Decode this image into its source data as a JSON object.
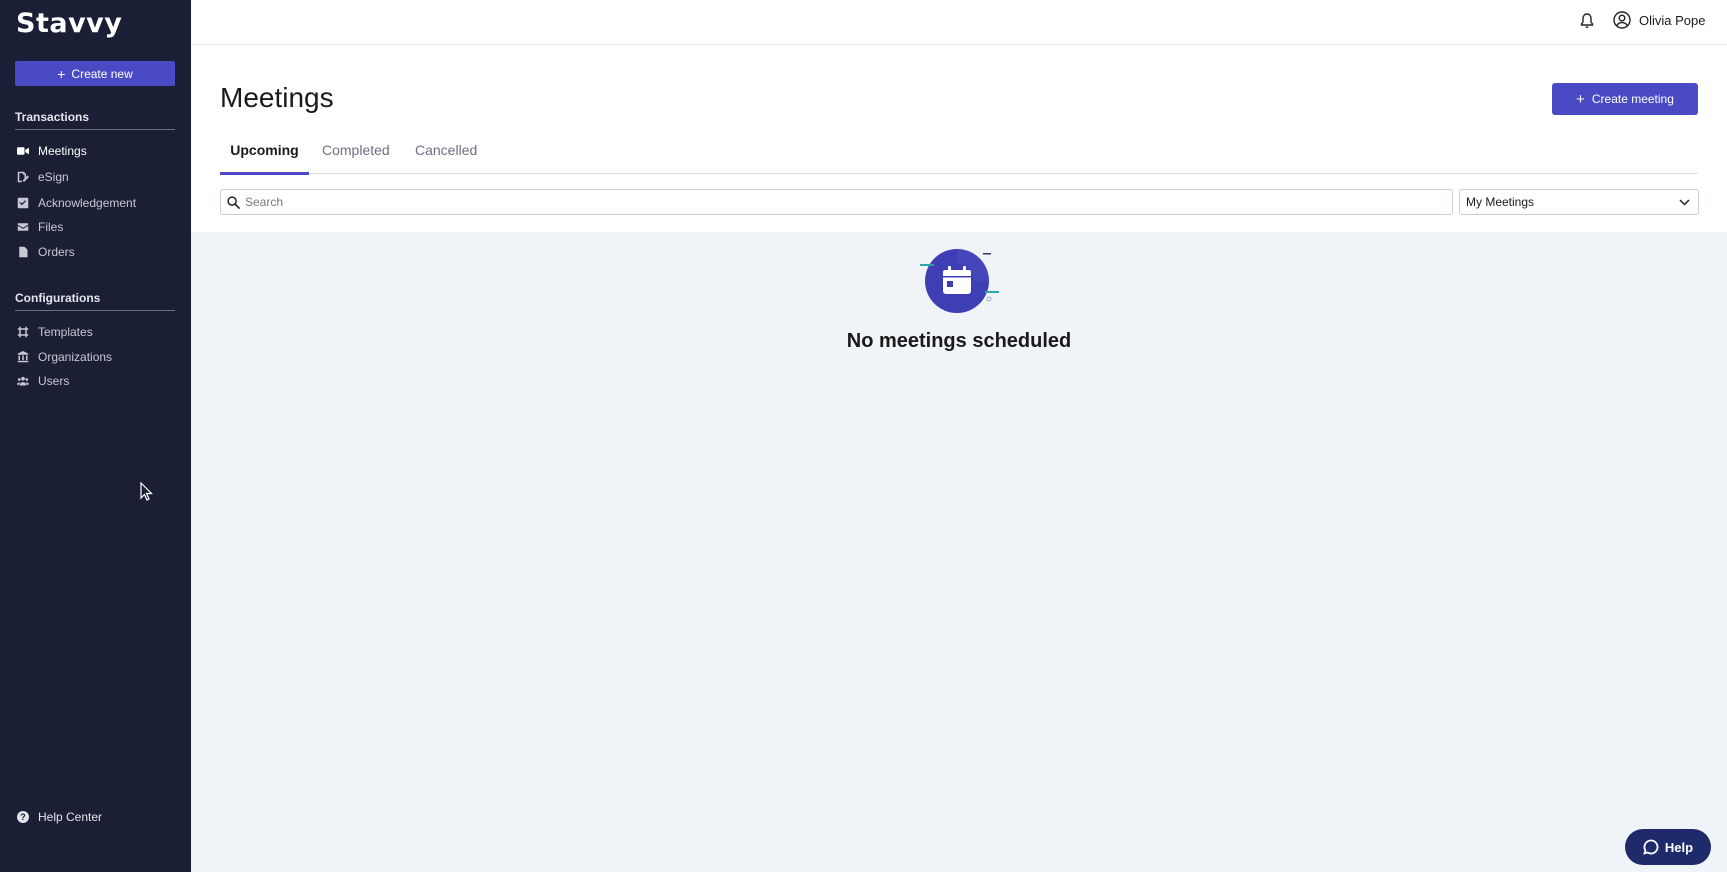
{
  "sidebar": {
    "logo": "Stavvy",
    "create_new": "Create new",
    "transactions_title": "Transactions",
    "transactions": [
      {
        "label": "Meetings",
        "icon": "video-icon",
        "active": true
      },
      {
        "label": "eSign",
        "icon": "signature-icon",
        "active": false
      },
      {
        "label": "Acknowledgement",
        "icon": "checkbox-icon",
        "active": false
      },
      {
        "label": "Files",
        "icon": "envelope-icon",
        "active": false
      },
      {
        "label": "Orders",
        "icon": "document-icon",
        "active": false
      }
    ],
    "configurations_title": "Configurations",
    "configurations": [
      {
        "label": "Templates",
        "icon": "template-icon"
      },
      {
        "label": "Organizations",
        "icon": "bank-icon"
      },
      {
        "label": "Users",
        "icon": "users-icon"
      }
    ],
    "help_center": "Help Center"
  },
  "topbar": {
    "user_name": "Olivia Pope"
  },
  "main": {
    "title": "Meetings",
    "create_meeting": "Create meeting",
    "tabs": [
      "Upcoming",
      "Completed",
      "Cancelled"
    ],
    "active_tab": "Upcoming",
    "search_placeholder": "Search",
    "filter_selected": "My Meetings",
    "empty_message": "No meetings scheduled"
  },
  "help_button": "Help",
  "colors": {
    "sidebar_bg": "#1a1f36",
    "accent": "#4a4bc4",
    "content_bg": "#f0f3f8",
    "help_bg": "#1f2a6b"
  }
}
